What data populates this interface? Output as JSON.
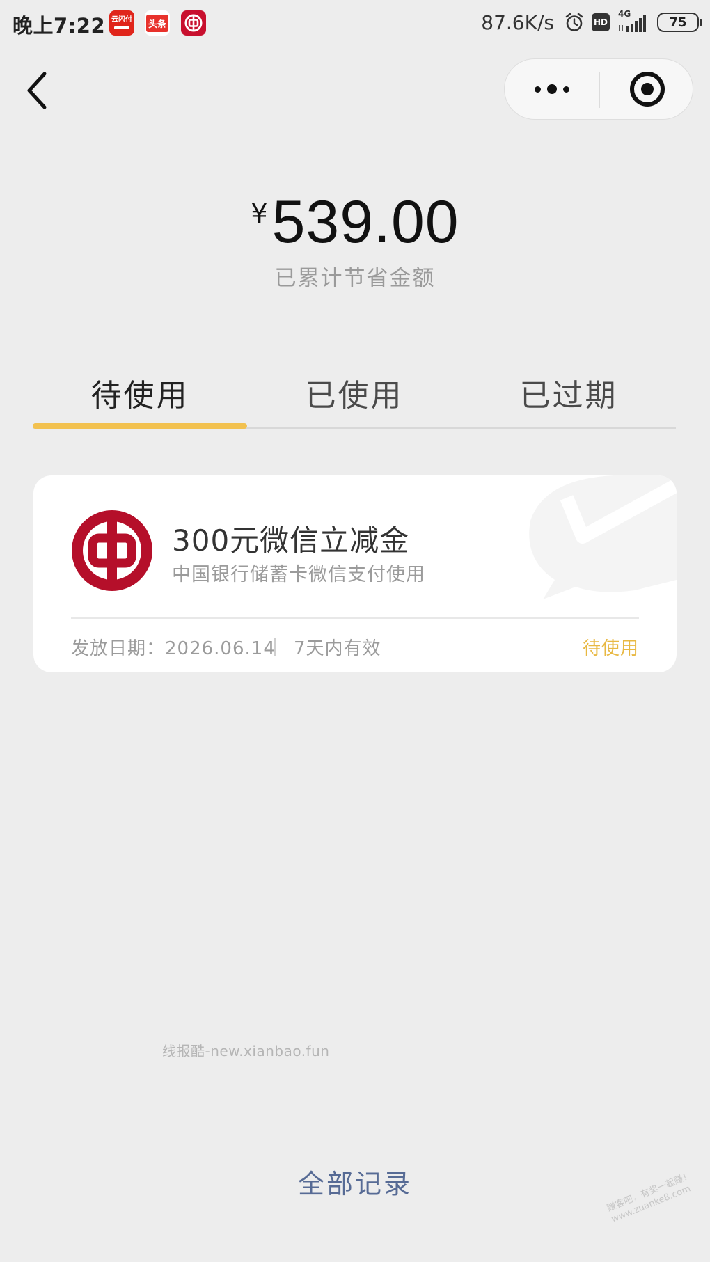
{
  "status_bar": {
    "time": "晚上7:22",
    "notifications": [
      {
        "name": "unionpay-icon",
        "label": "云闪付"
      },
      {
        "name": "toutiao-icon",
        "label": "头条"
      },
      {
        "name": "boc-app-icon",
        "label": ""
      }
    ],
    "net_speed": "87.6K/s",
    "hd_label": "HD",
    "network_type": "4G",
    "battery_level": "75"
  },
  "nav": {
    "back_icon": "chevron-left-icon",
    "more_icon": "more-dots-icon",
    "close_icon": "target-icon"
  },
  "summary": {
    "currency_symbol": "¥",
    "amount": "539.00",
    "caption": "已累计节省金额"
  },
  "tabs": [
    {
      "label": "待使用",
      "active": true
    },
    {
      "label": "已使用",
      "active": false
    },
    {
      "label": "已过期",
      "active": false
    }
  ],
  "coupon": {
    "title": "300元微信立减金",
    "description": "中国银行储蓄卡微信支付使用",
    "issue_date": "发放日期：2026.06.14",
    "validity": "7天内有效",
    "status": "待使用"
  },
  "watermark_text": "线报酷-new.xianbao.fun",
  "footer": {
    "all_records": "全部记录"
  },
  "corner_stamp": {
    "line1": "赚客吧，有奖一起赚！",
    "line2": "www.zuanke8.com"
  },
  "colors": {
    "background": "#ededed",
    "tab_indicator": "#f2c14f",
    "status_pending": "#e8b842",
    "link": "#576b95",
    "boc_red": "#c8102e"
  }
}
